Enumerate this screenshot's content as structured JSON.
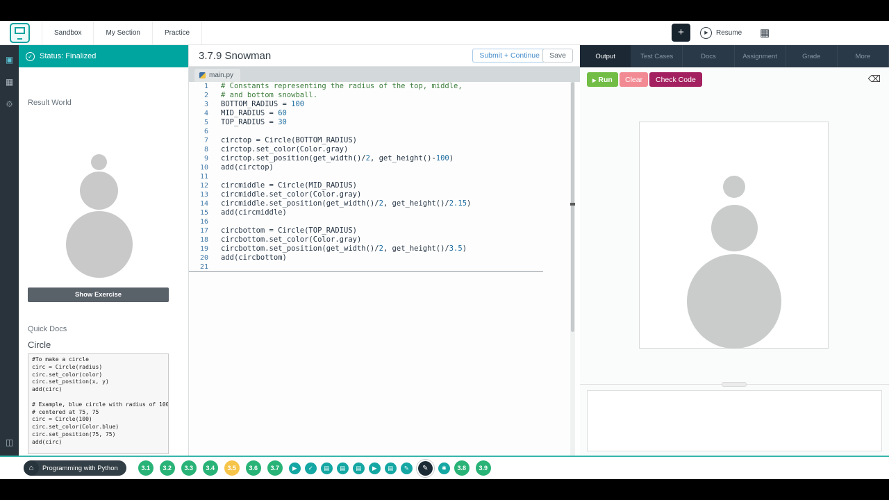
{
  "icons": {
    "check": "✓",
    "play": "▶",
    "home": "⌂",
    "video": "▶",
    "doc": "▤",
    "pencil": "✎",
    "asterisk": "✱",
    "backspace": "⌫",
    "calendar": "▦",
    "gear": "⚙",
    "grid": "▣",
    "panel": "◫"
  },
  "top_nav": {
    "tabs": [
      "Sandbox",
      "My Section",
      "Practice"
    ],
    "plus_label": "+",
    "resume_label": "Resume"
  },
  "left_panel": {
    "status_label": "Status: Finalized",
    "result_world_label": "Result World",
    "show_exercise_label": "Show Exercise",
    "quick_docs_label": "Quick Docs",
    "docs_heading": "Circle",
    "docs_lines": [
      "#To make a circle",
      "circ = Circle(radius)",
      "circ.set_color(color)",
      "circ.set_position(x, y)",
      "add(circ)",
      "",
      "# Example, blue circle with radius of 100",
      "# centered at 75, 75",
      "circ = Circle(100)",
      "circ.set_color(Color.blue)",
      "circ.set_position(75, 75)",
      "add(circ)"
    ]
  },
  "editor": {
    "title": "3.7.9 Snowman",
    "submit_label": "Submit + Continue",
    "save_label": "Save",
    "file_tab_label": "main.py",
    "code_lines": [
      "# Constants representing the radius of the top, middle,",
      "# and bottom snowball.",
      "BOTTOM_RADIUS = 100",
      "MID_RADIUS = 60",
      "TOP_RADIUS = 30",
      "",
      "circtop = Circle(BOTTOM_RADIUS)",
      "circtop.set_color(Color.gray)",
      "circtop.set_position(get_width()/2, get_height()-100)",
      "add(circtop)",
      "",
      "circmiddle = Circle(MID_RADIUS)",
      "circmiddle.set_color(Color.gray)",
      "circmiddle.set_position(get_width()/2, get_height()/2.15)",
      "add(circmiddle)",
      "",
      "circbottom = Circle(TOP_RADIUS)",
      "circbottom.set_color(Color.gray)",
      "circbottom.set_position(get_width()/2, get_height()/3.5)",
      "add(circbottom)",
      ""
    ]
  },
  "right_panel": {
    "tabs": [
      "Output",
      "Test Cases",
      "Docs",
      "Assignment",
      "Grade",
      "More"
    ],
    "active_tab": "Output",
    "run_label": "Run",
    "clear_label": "Clear",
    "check_code_label": "Check Code"
  },
  "bottom_bar": {
    "course_label": "Programming with Python",
    "items": [
      {
        "kind": "lesson",
        "label": "3.1",
        "color": "green"
      },
      {
        "kind": "lesson",
        "label": "3.2",
        "color": "green"
      },
      {
        "kind": "lesson",
        "label": "3.3",
        "color": "green"
      },
      {
        "kind": "lesson",
        "label": "3.4",
        "color": "green"
      },
      {
        "kind": "lesson",
        "label": "3.5",
        "color": "yellow"
      },
      {
        "kind": "lesson",
        "label": "3.6",
        "color": "green"
      },
      {
        "kind": "lesson",
        "label": "3.7",
        "color": "green"
      },
      {
        "kind": "icon",
        "icon": "video"
      },
      {
        "kind": "icon",
        "icon": "check"
      },
      {
        "kind": "icon",
        "icon": "doc"
      },
      {
        "kind": "icon",
        "icon": "doc"
      },
      {
        "kind": "icon",
        "icon": "doc"
      },
      {
        "kind": "icon",
        "icon": "video"
      },
      {
        "kind": "icon",
        "icon": "doc"
      },
      {
        "kind": "icon",
        "icon": "pencil"
      },
      {
        "kind": "icon",
        "icon": "pencil",
        "selected": true
      },
      {
        "kind": "icon",
        "icon": "asterisk"
      },
      {
        "kind": "lesson",
        "label": "3.8",
        "color": "green"
      },
      {
        "kind": "lesson",
        "label": "3.9",
        "color": "green"
      }
    ]
  },
  "colors": {
    "brand_teal": "#00a59f",
    "lesson_green": "#29b377",
    "lesson_yellow": "#f6c449",
    "run_green": "#71bd45",
    "clear_pink": "#f28a93",
    "check_maroon": "#a32160"
  }
}
